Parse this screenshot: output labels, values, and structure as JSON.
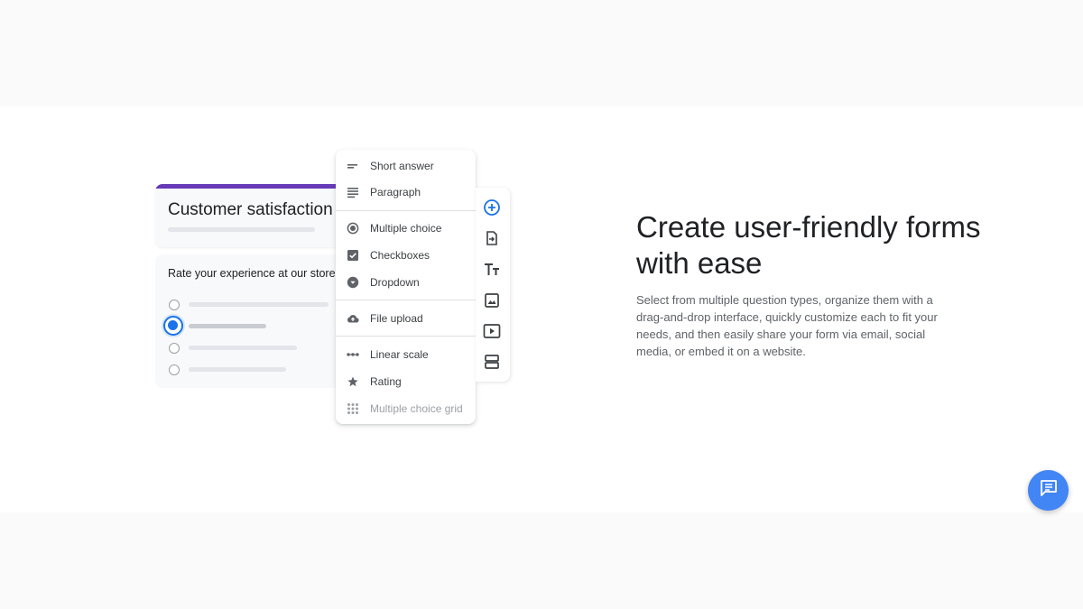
{
  "form": {
    "title": "Customer satisfaction",
    "question": "Rate your experience at our store",
    "accent_color": "#673ab7",
    "selected_option_index": 1
  },
  "question_types": {
    "items": [
      {
        "label": "Short answer",
        "icon": "short-answer-icon"
      },
      {
        "label": "Paragraph",
        "icon": "paragraph-icon"
      },
      {
        "label": "Multiple choice",
        "icon": "radio-button-icon"
      },
      {
        "label": "Checkboxes",
        "icon": "checkbox-icon"
      },
      {
        "label": "Dropdown",
        "icon": "dropdown-icon"
      },
      {
        "label": "File upload",
        "icon": "cloud-upload-icon"
      },
      {
        "label": "Linear scale",
        "icon": "linear-scale-icon"
      },
      {
        "label": "Rating",
        "icon": "star-icon"
      },
      {
        "label": "Multiple choice grid",
        "icon": "grid-icon"
      }
    ]
  },
  "toolbar": {
    "tools": [
      "add-question-icon",
      "import-questions-icon",
      "add-title-icon",
      "add-image-icon",
      "add-video-icon",
      "add-section-icon"
    ],
    "accent_color": "#1a73e8"
  },
  "hero": {
    "headline": "Create user-friendly forms with ease",
    "description": "Select from multiple question types, organize them with a drag-and-drop interface, quickly customize each to fit your needs, and then easily share your form via email, social media, or embed it on a website."
  },
  "chat": {
    "icon": "chat-icon",
    "color": "#4285f4"
  }
}
